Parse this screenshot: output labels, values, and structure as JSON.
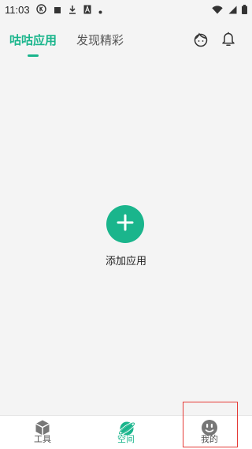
{
  "status_bar": {
    "time": "11:03",
    "left_icons": [
      "k-circle-icon",
      "square-icon",
      "download-icon",
      "font-a-icon",
      "dot-icon"
    ],
    "right_icons": [
      "wifi-icon",
      "signal-icon",
      "battery-icon"
    ]
  },
  "header": {
    "tabs": [
      {
        "label": "咕咕应用",
        "active": true
      },
      {
        "label": "发现精彩",
        "active": false
      }
    ],
    "right_icons": [
      "face-avatar-icon",
      "bell-icon"
    ]
  },
  "main": {
    "add_app_label": "添加应用",
    "add_icon": "plus-icon"
  },
  "bottom_nav": {
    "items": [
      {
        "label": "工具",
        "icon": "cube-icon",
        "active": false
      },
      {
        "label": "空间",
        "icon": "planet-icon",
        "active": true
      },
      {
        "label": "我的",
        "icon": "smiley-icon",
        "active": false
      }
    ]
  },
  "colors": {
    "accent": "#1ab58c",
    "background": "#f4f4f4",
    "highlight": "#e53935"
  }
}
